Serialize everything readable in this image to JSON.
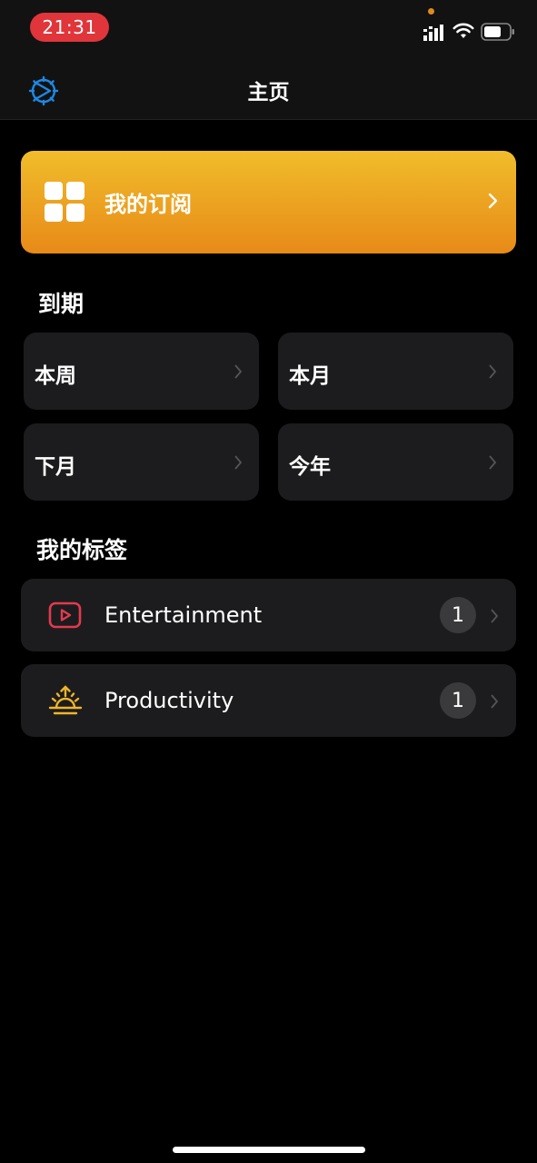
{
  "status_bar": {
    "time": "21:31",
    "time_pill_color": "#e0353a",
    "icons": [
      "signal-icon",
      "wifi-icon",
      "battery-icon"
    ]
  },
  "nav": {
    "title": "主页",
    "settings_icon": "gear-icon",
    "accent": "#1e88e5"
  },
  "subscriptions_banner": {
    "label": "我的订阅",
    "icon": "grid-icon",
    "colors": [
      "#f0bd2b",
      "#e88a18"
    ]
  },
  "due_section": {
    "title": "到期",
    "tiles": [
      {
        "label": "本周"
      },
      {
        "label": "本月"
      },
      {
        "label": "下月"
      },
      {
        "label": "今年"
      }
    ]
  },
  "tags_section": {
    "title": "我的标签",
    "items": [
      {
        "label": "Entertainment",
        "count": "1",
        "icon": "play-button-icon",
        "color": "#e23a4e"
      },
      {
        "label": "Productivity",
        "count": "1",
        "icon": "sunrise-icon",
        "color": "#f0b52b"
      }
    ]
  }
}
